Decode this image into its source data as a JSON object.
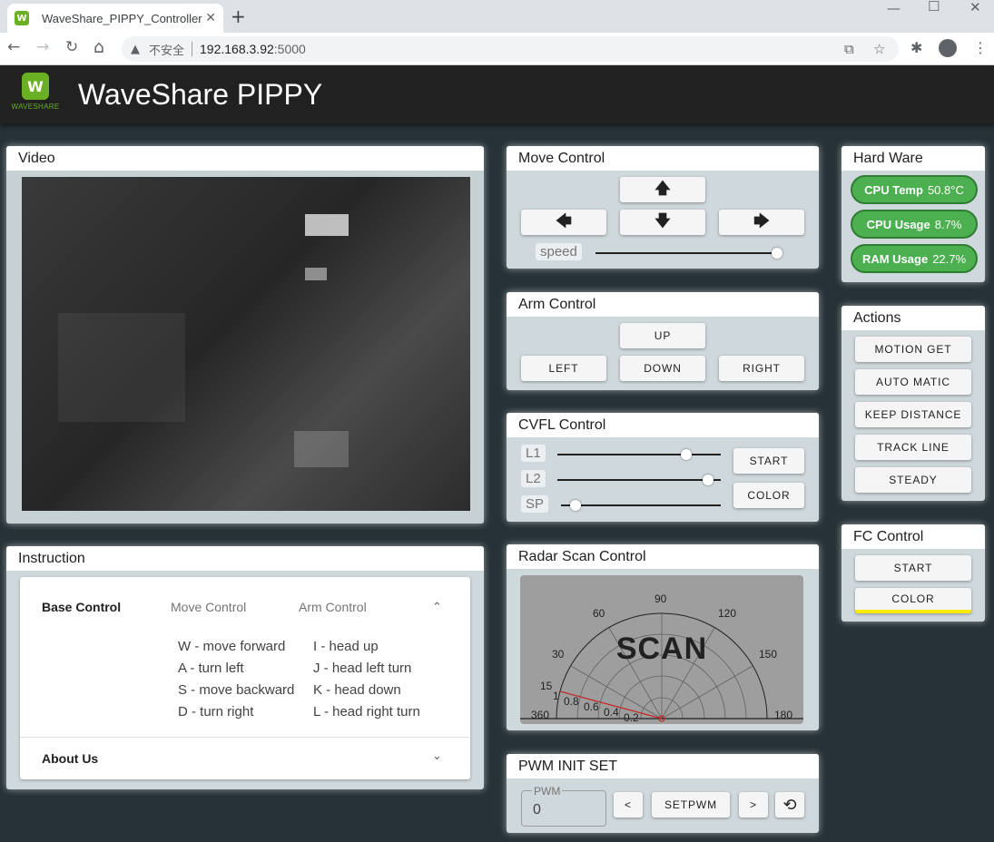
{
  "browser": {
    "tab_title": "WaveShare_PIPPY_Controller",
    "favicon": "W",
    "tab_close": "✕",
    "new_tab": "+",
    "window_controls": {
      "minimize": "—",
      "maximize": "☐",
      "close": "✕"
    },
    "nav": {
      "back": "←",
      "forward": "→",
      "reload": "↻",
      "home": "⌂"
    },
    "security_icon": "▲",
    "security_label": "不安全",
    "url_host": "192.168.3.92",
    "url_port": ":5000",
    "omni_icons": {
      "translate": "⧉",
      "star": "☆"
    },
    "toolbar_icons": {
      "extensions": "✱",
      "menu": "⋮"
    }
  },
  "header": {
    "logo_mark": "W",
    "logo_text": "WAVESHARE",
    "title": "WaveShare PIPPY"
  },
  "video": {
    "title": "Video"
  },
  "instruction": {
    "title": "Instruction",
    "tabs": [
      "Base Control",
      "Move Control",
      "Arm Control"
    ],
    "active_tab": "Base Control",
    "expand_open": "⌃",
    "expand_closed": "⌄",
    "move_lines": [
      "W - move forward",
      "A - turn left",
      "S - move backward",
      "D - turn right"
    ],
    "arm_lines": [
      "I - head up",
      "J - head left turn",
      "K - head down",
      "L - head right turn"
    ],
    "about": "About Us"
  },
  "move_control": {
    "title": "Move Control",
    "up": "🡅",
    "left": "🡄",
    "down": "🡇",
    "right": "🡆",
    "speed_label": "speed",
    "speed_value": 1.0
  },
  "arm_control": {
    "title": "Arm Control",
    "up": "UP",
    "left": "LEFT",
    "down": "DOWN",
    "right": "RIGHT"
  },
  "cvfl_control": {
    "title": "CVFL Control",
    "sliders": [
      {
        "label": "L1",
        "value": 0.79
      },
      {
        "label": "L2",
        "value": 0.92
      },
      {
        "label": "SP",
        "value": 0.09
      }
    ],
    "start": "START",
    "color": "COLOR"
  },
  "radar": {
    "title": "Radar Scan Control",
    "overlay": "SCAN",
    "angle_labels": [
      "90",
      "60",
      "120",
      "30",
      "150",
      "15",
      "360",
      "180"
    ],
    "radius_labels": [
      "1",
      "0.8",
      "0.6",
      "0.4",
      "0.2"
    ]
  },
  "pwm": {
    "title": "PWM INIT SET",
    "field_label": "PWM",
    "value": "0",
    "prev": "<",
    "set": "SETPWM",
    "next": ">",
    "reset_icon": "⟲"
  },
  "hardware": {
    "title": "Hard Ware",
    "stats": [
      {
        "label": "CPU Temp",
        "value": "50.8°C"
      },
      {
        "label": "CPU Usage",
        "value": "8.7%"
      },
      {
        "label": "RAM Usage",
        "value": "22.7%"
      }
    ],
    "status_color": "#4caf50"
  },
  "actions": {
    "title": "Actions",
    "buttons": [
      "MOTION GET",
      "AUTO MATIC",
      "KEEP DISTANCE",
      "TRACK LINE",
      "STEADY"
    ]
  },
  "fc_control": {
    "title": "FC Control",
    "start": "START",
    "color": "COLOR",
    "color_swatch": "#ffeb00"
  }
}
